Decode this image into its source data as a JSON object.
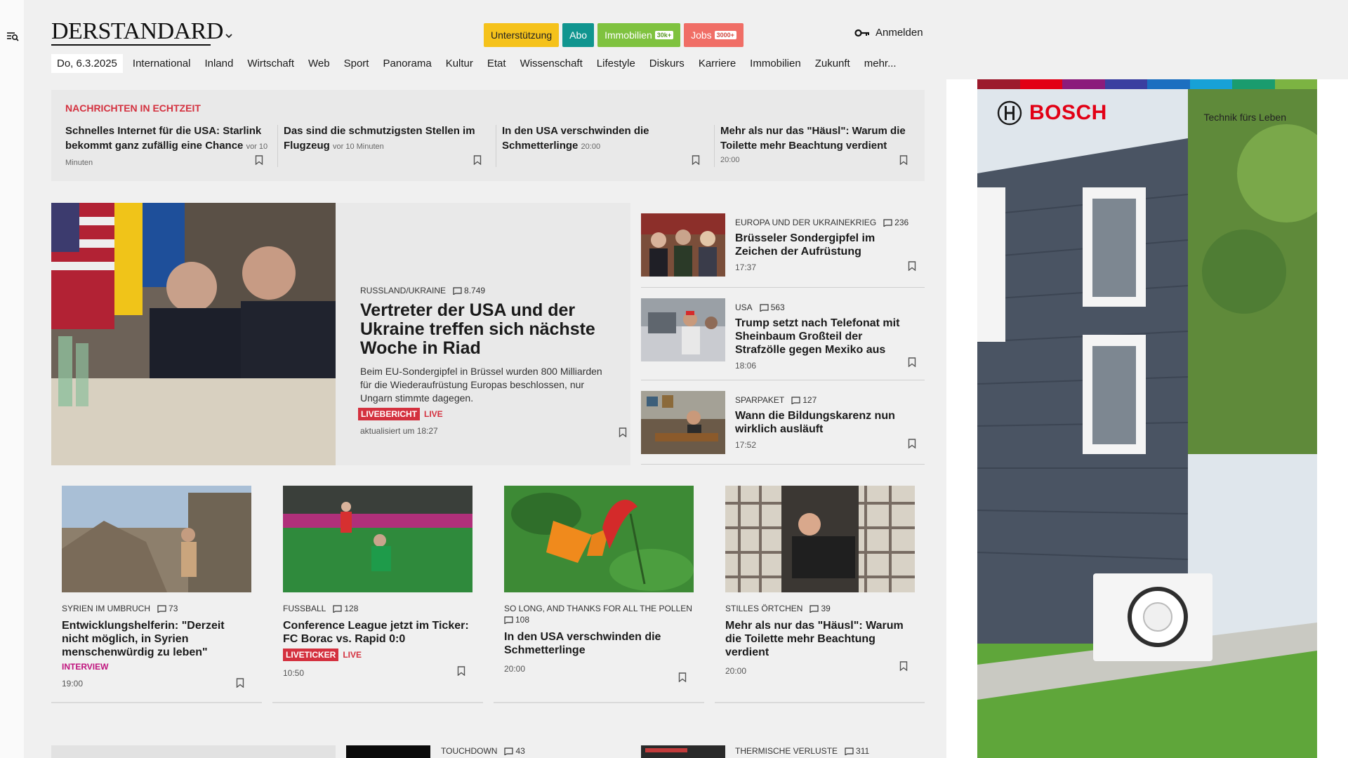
{
  "sidebar": {
    "menu_icon": "search-menu-icon"
  },
  "header": {
    "logo": "DERSTANDARD",
    "buttons": {
      "support": "Unterstützung",
      "abo": "Abo",
      "immobilien": "Immobilien",
      "immobilien_badge": "30k+",
      "jobs": "Jobs",
      "jobs_badge": "3000+"
    },
    "login": "Anmelden"
  },
  "nav": {
    "date": "Do, 6.3.2025",
    "items": [
      "International",
      "Inland",
      "Wirtschaft",
      "Web",
      "Sport",
      "Panorama",
      "Kultur",
      "Etat",
      "Wissenschaft",
      "Lifestyle",
      "Diskurs",
      "Karriere",
      "Immobilien",
      "Zukunft",
      "mehr..."
    ]
  },
  "ticker": {
    "heading": "NACHRICHTEN IN ECHTZEIT",
    "items": [
      {
        "title": "Schnelles Internet für die USA: Starlink bekommt ganz zufällig eine Chance",
        "time": "vor 10 Minuten"
      },
      {
        "title": "Das sind die schmutzigsten Stellen im Flugzeug",
        "time": "vor 10 Minuten"
      },
      {
        "title": "In den USA verschwinden die Schmetterlinge",
        "time": "20:00"
      },
      {
        "title": "Mehr als nur das \"Häusl\": Warum die Toilette mehr Beachtung verdient",
        "time": "20:00"
      }
    ]
  },
  "lead": {
    "kicker": "RUSSLAND/UKRAINE",
    "comments": "8.749",
    "title": "Vertreter der USA und der Ukraine treffen sich nächste Woche in Riad",
    "teaser": "Beim EU-Sondergipfel in Brüssel wurden 800 Milliarden für die Wiederaufrüstung Europas beschlossen, nur Ungarn stimmte dagegen.",
    "label": "LIVEBERICHT",
    "live": "LIVE",
    "updated": "aktualisiert um 18:27"
  },
  "side": [
    {
      "kicker": "EUROPA UND DER UKRAINEKRIEG",
      "comments": "236",
      "title": "Brüsseler Sondergipfel im Zeichen der Aufrüstung",
      "time": "17:37"
    },
    {
      "kicker": "USA",
      "comments": "563",
      "title": "Trump setzt nach Telefonat mit Sheinbaum Großteil der Strafzölle gegen Mexiko aus",
      "time": "18:06"
    },
    {
      "kicker": "SPARPAKET",
      "comments": "127",
      "title": "Wann die Bildungskarenz nun wirklich ausläuft",
      "time": "17:52"
    }
  ],
  "cards": [
    {
      "kicker": "SYRIEN IM UMBRUCH",
      "comments": "73",
      "title": "Entwicklungshelferin: \"Derzeit nicht möglich, in Syrien menschenwürdig zu leben\"",
      "label": "INTERVIEW",
      "time": "19:00"
    },
    {
      "kicker": "FUSSBALL",
      "comments": "128",
      "title": "Conference League jetzt im Ticker: FC Borac vs. Rapid 0:0",
      "label": "LIVETICKER",
      "live": "LIVE",
      "time": "10:50"
    },
    {
      "kicker": "SO LONG, AND THANKS FOR ALL THE POLLEN",
      "comments": "108",
      "title": "In den USA verschwinden die Schmetterlinge",
      "time": "20:00"
    },
    {
      "kicker": "STILLES ÖRTCHEN",
      "comments": "39",
      "title": "Mehr als nur das \"Häusl\": Warum die Toilette mehr Beachtung verdient",
      "time": "20:00"
    }
  ],
  "bottom": [
    {
      "kicker": "TOUCHDOWN",
      "comments": "43"
    },
    {
      "kicker": "THERMISCHE VERLUSTE",
      "comments": "311"
    }
  ],
  "ad": {
    "brand": "BOSCH",
    "slogan": "Technik fürs Leben",
    "bar_colors": [
      "#9c1a2c",
      "#e20015",
      "#8b1b7b",
      "#3a3fa0",
      "#1c6fc0",
      "#17a1d6",
      "#1a9c6e",
      "#7cb342"
    ]
  }
}
